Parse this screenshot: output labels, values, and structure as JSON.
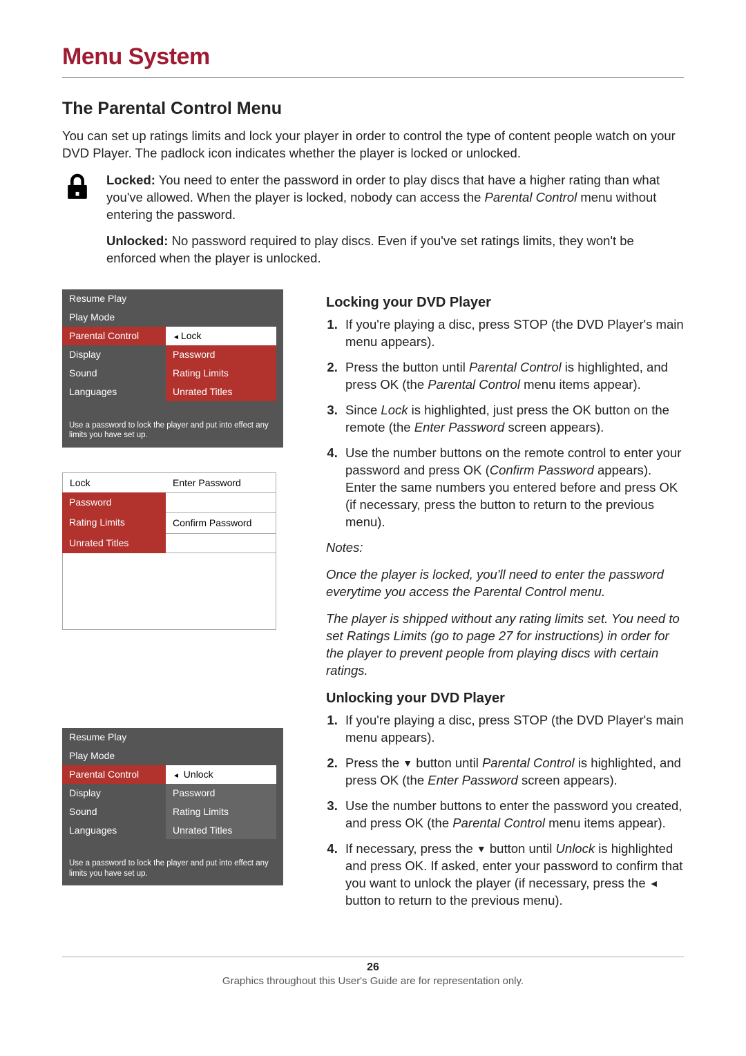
{
  "header": {
    "title": "Menu System"
  },
  "section": {
    "title": "The Parental Control Menu",
    "intro": "You can set up ratings limits and lock your player in order to control the type of content people watch on your DVD Player. The padlock icon indicates whether the player is locked or unlocked.",
    "locked_label": "Locked:",
    "locked_text": " You need to enter the password in order to play discs that have a higher rating than what you've allowed. When the player is locked, nobody can access the ",
    "locked_text_italic": "Parental Control",
    "locked_text_end": " menu without entering the password.",
    "unlocked_label": "Unlocked:",
    "unlocked_text": " No password required to play discs. Even if you've set ratings limits, they won't be enforced when the player is unlocked."
  },
  "menu1": {
    "left": [
      "Resume Play",
      "Play Mode",
      "Parental Control",
      "Display",
      "Sound",
      "Languages"
    ],
    "right": [
      "Lock",
      "Password",
      "Rating Limits",
      "Unrated Titles"
    ],
    "note": "Use a password to lock the player and put into effect any limits you have set up."
  },
  "menu2": {
    "left": [
      "Lock",
      "Password",
      "Rating Limits",
      "Unrated Titles"
    ],
    "right": [
      "Enter Password",
      "",
      "Confirm Password",
      ""
    ]
  },
  "menu3": {
    "left": [
      "Resume Play",
      "Play Mode",
      "Parental Control",
      "Display",
      "Sound",
      "Languages"
    ],
    "right": [
      "Unlock",
      "Password",
      "Rating Limits",
      "Unrated Titles"
    ],
    "note": "Use a password to lock the player and put into effect any limits you have set up."
  },
  "locking": {
    "heading": "Locking your DVD Player",
    "steps": [
      "If you're playing a disc, press STOP (the DVD Player's main menu appears).",
      {
        "pre": "Press the      button until ",
        "it1": "Parental Control",
        "mid": " is highlighted, and press OK (the ",
        "it2": "Parental Control",
        "end": " menu items appear)."
      },
      {
        "pre": "Since ",
        "it1": "Lock",
        "mid": " is highlighted, just press the OK button on the remote (the ",
        "it2": "Enter Password",
        "end": " screen appears)."
      },
      {
        "pre": "Use the number buttons on the remote control to enter your password and press OK (",
        "it1": "Confirm Password",
        "mid": " appears). Enter the same numbers you entered before and press OK (if necessary, press the      button to return to the previous menu).",
        "it2": "",
        "end": ""
      }
    ],
    "notes_label": "Notes:",
    "note1": "Once the player is locked, you'll need to enter the password everytime you access the Parental Control menu.",
    "note2": "The player is shipped without any rating limits set. You need to set Ratings Limits (go to page 27 for instructions) in order for the player to prevent people from playing discs with certain ratings."
  },
  "unlocking": {
    "heading": "Unlocking your DVD Player",
    "steps": [
      "If you're playing a disc, press STOP (the DVD Player's main menu appears).",
      {
        "pre": "Press the ",
        "arrow": "down",
        "mid": " button until ",
        "it1": "Parental Control",
        "mid2": " is highlighted, and press OK (the ",
        "it2": "Enter Password",
        "end": " screen appears)."
      },
      {
        "pre": "Use the number buttons to enter the password you created, and press OK (the ",
        "it1": "Parental Control",
        "end": " menu items appear)."
      },
      {
        "pre": "If necessary, press the ",
        "arrow": "down",
        "mid": " button until ",
        "it1": "Unlock",
        "mid2": " is highlighted and press OK. If asked, enter your password to confirm that you want to unlock the player (if necessary, press the ",
        "arrow2": "left",
        "end": " button to return to the previous menu)."
      }
    ]
  },
  "footer": {
    "page": "26",
    "note": "Graphics throughout this User's Guide are for representation only."
  }
}
